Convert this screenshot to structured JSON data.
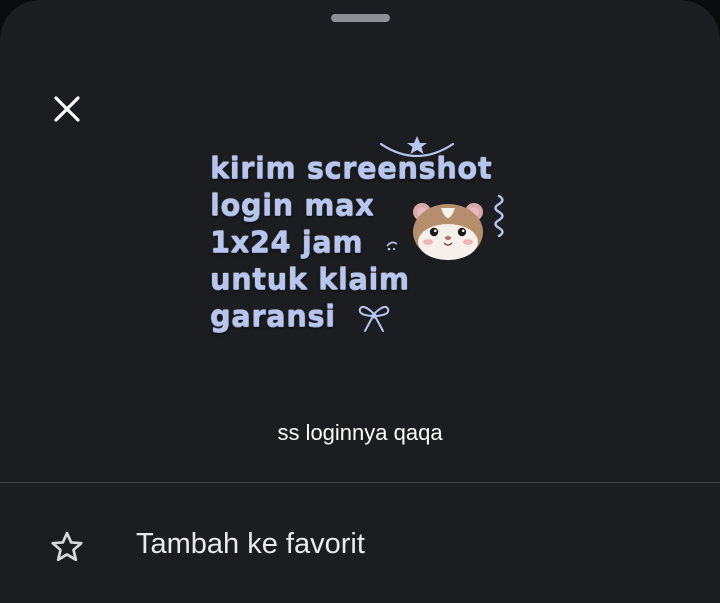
{
  "sheet": {
    "close_icon": "close-icon",
    "sticker": {
      "lines": [
        "kirim screenshot",
        "login max",
        "1x24 jam",
        "untuk klaim",
        "garansi"
      ],
      "decorations": [
        "star-icon",
        "hamster-icon",
        "ribbon-icon",
        "sparkle-icon"
      ]
    },
    "caption": "ss loginnya qaqa"
  },
  "menu": {
    "items": [
      {
        "icon": "star-outline-icon",
        "label": "Tambah ke favorit"
      }
    ]
  },
  "colors": {
    "sheet_background": "#1b1d21",
    "text_primary": "#ffffff",
    "sticker_text": "#b7c6ef",
    "divider": "#43464b",
    "handle": "#8d8f94"
  }
}
